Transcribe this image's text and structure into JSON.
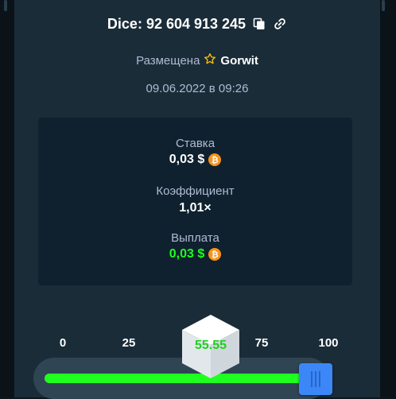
{
  "bet": {
    "title": "Dice: 92 604 913 245",
    "placed_label": "Размещена",
    "user": "Gorwit",
    "date": "09.06.2022 в 09:26"
  },
  "stats": {
    "wager_label": "Ставка",
    "wager_value": "0,03 $",
    "multiplier_label": "Коэффициент",
    "multiplier_value": "1,01×",
    "payout_label": "Выплата",
    "payout_value": "0,03 $",
    "currency_symbol": "₿",
    "currency_icon": "bitcoin-icon"
  },
  "slider": {
    "ticks": [
      "0",
      "25",
      "75",
      "100"
    ],
    "target_value": 99,
    "result": "55.55"
  },
  "colors": {
    "background": "#1a2c38",
    "win_green": "#1fff20",
    "lose_red": "#ff0a4a",
    "handle_blue": "#3b87f7",
    "bitcoin_orange": "#f7931a",
    "star_gold": "#ffc107"
  },
  "icons": {
    "copy": "copy-icon",
    "link": "link-icon",
    "star": "star-icon"
  }
}
